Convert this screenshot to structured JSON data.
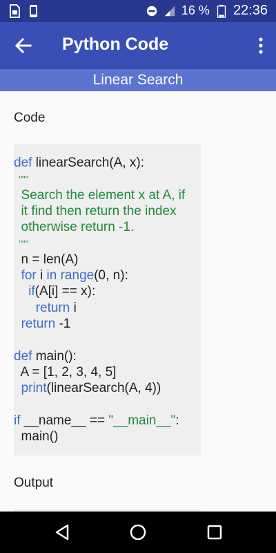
{
  "status_bar": {
    "battery_percent": "16 %",
    "time": "22:36",
    "icons": [
      "sim-card-icon",
      "phone-icon",
      "do-not-disturb-icon",
      "signal-icon",
      "battery-icon"
    ]
  },
  "app_bar": {
    "title": "Python Code",
    "back_icon": "arrow-back-icon",
    "menu_icon": "more-vert-icon"
  },
  "sub_header": {
    "title": "Linear Search"
  },
  "sections": {
    "code_label": "Code",
    "output_label": "Output"
  },
  "code": {
    "lines": [
      {
        "segments": [
          {
            "t": "def",
            "c": "kw"
          },
          {
            "t": " linearSearch(A, x):",
            "c": ""
          }
        ]
      },
      {
        "segments": [
          {
            "t": "  \"\"\"",
            "c": "doc",
            "small": true
          }
        ]
      },
      {
        "segments": [
          {
            "t": "  Search the element x at A, if",
            "c": "doc"
          }
        ]
      },
      {
        "segments": [
          {
            "t": "  it find then return the index",
            "c": "doc"
          }
        ]
      },
      {
        "segments": [
          {
            "t": "  otherwise return -1.",
            "c": "doc"
          }
        ]
      },
      {
        "segments": [
          {
            "t": "  \"\"\"",
            "c": "doc",
            "small": true
          }
        ]
      },
      {
        "segments": [
          {
            "t": "  n = len(A)",
            "c": ""
          }
        ]
      },
      {
        "segments": [
          {
            "t": "  ",
            "c": ""
          },
          {
            "t": "for",
            "c": "kw"
          },
          {
            "t": " i ",
            "c": ""
          },
          {
            "t": "in",
            "c": "kw"
          },
          {
            "t": " ",
            "c": ""
          },
          {
            "t": "range",
            "c": "kw"
          },
          {
            "t": "(0, n):",
            "c": ""
          }
        ]
      },
      {
        "segments": [
          {
            "t": "    ",
            "c": ""
          },
          {
            "t": "if",
            "c": "kw"
          },
          {
            "t": "(A[i] == x):",
            "c": ""
          }
        ]
      },
      {
        "segments": [
          {
            "t": "      ",
            "c": ""
          },
          {
            "t": "return",
            "c": "kw"
          },
          {
            "t": " i",
            "c": ""
          }
        ]
      },
      {
        "segments": [
          {
            "t": "  ",
            "c": ""
          },
          {
            "t": "return",
            "c": "kw"
          },
          {
            "t": " -1",
            "c": ""
          }
        ]
      },
      {
        "segments": [
          {
            "t": "",
            "c": ""
          }
        ]
      },
      {
        "segments": [
          {
            "t": "def",
            "c": "kw"
          },
          {
            "t": " main():",
            "c": ""
          }
        ]
      },
      {
        "segments": [
          {
            "t": "  A = [1, 2, 3, 4, 5]",
            "c": ""
          }
        ]
      },
      {
        "segments": [
          {
            "t": "  ",
            "c": ""
          },
          {
            "t": "print",
            "c": "kw"
          },
          {
            "t": "(linearSearch(A, 4))",
            "c": ""
          }
        ]
      },
      {
        "segments": [
          {
            "t": "",
            "c": ""
          }
        ]
      },
      {
        "segments": [
          {
            "t": "if",
            "c": "kw"
          },
          {
            "t": " __name__ == ",
            "c": ""
          },
          {
            "t": "\"__main__\"",
            "c": "str"
          },
          {
            "t": ":",
            "c": ""
          }
        ]
      },
      {
        "segments": [
          {
            "t": "  main()",
            "c": ""
          }
        ]
      }
    ]
  },
  "nav_bar": {
    "icons": [
      "back-triangle-icon",
      "home-circle-icon",
      "recents-square-icon"
    ]
  },
  "colors": {
    "status_bar": "#28378f",
    "app_bar": "#3a4fb5",
    "sub_header": "#5d73d0",
    "keyword": "#3b6ec7",
    "docstring": "#1e8a3a"
  }
}
